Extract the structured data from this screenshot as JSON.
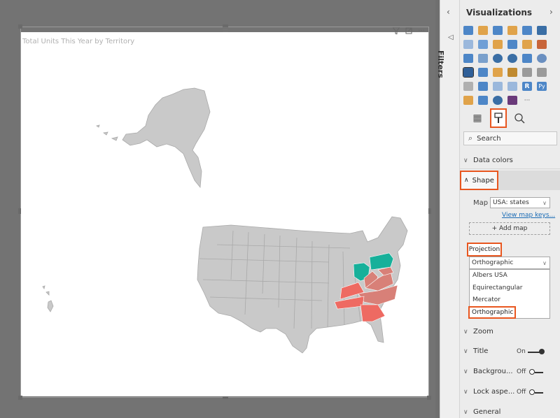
{
  "visual": {
    "title": "Total Units This Year by Territory",
    "header_icons": [
      "filter-icon",
      "focus-mode-icon",
      "more-options-icon"
    ]
  },
  "filters_pane": {
    "label": "Filters"
  },
  "visualizations_pane": {
    "title": "Visualizations",
    "tabs": [
      "fields-tab",
      "format-tab",
      "analytics-tab"
    ],
    "active_tab": "format-tab",
    "search_placeholder": "Search",
    "sections": {
      "data_colors": "Data colors",
      "shape": "Shape",
      "zoom": "Zoom",
      "title": "Title",
      "background": "Backgrou...",
      "lock_aspect": "Lock aspe...",
      "general": "General"
    },
    "shape": {
      "map_label": "Map",
      "map_value": "USA: states",
      "view_map_keys": "View map keys...",
      "add_map": "+ Add map",
      "projection_label": "Projection",
      "projection_value": "Orthographic",
      "projection_options": [
        "Albers USA",
        "Equirectangular",
        "Mercator",
        "Orthographic"
      ]
    },
    "toggles": {
      "title": "On",
      "background": "Off",
      "lock_aspect": "Off"
    }
  },
  "colors": {
    "accent": "#e8561f",
    "state_default": "#c9c9c9",
    "state_teal": "#17b09a",
    "state_salmon": "#ee6a62",
    "state_mid": "#d88078"
  },
  "map": {
    "highlighted_states_teal": [
      "Ohio",
      "Pennsylvania"
    ],
    "highlighted_states_salmon": [
      "Tennessee",
      "South Carolina",
      "North Carolina",
      "Virginia",
      "West Virginia",
      "Maryland"
    ]
  }
}
